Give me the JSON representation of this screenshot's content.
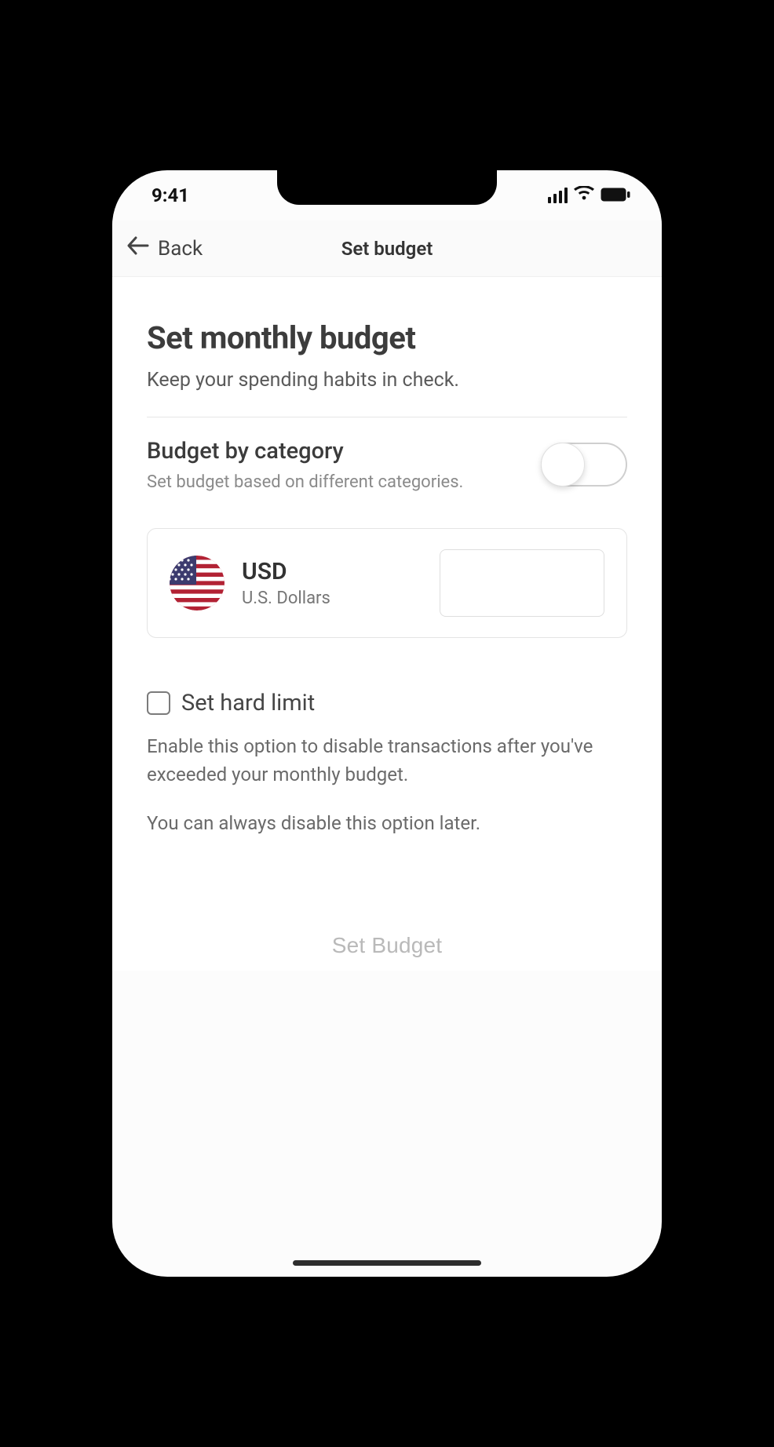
{
  "status": {
    "time": "9:41"
  },
  "nav": {
    "back_label": "Back",
    "title": "Set budget"
  },
  "header": {
    "title": "Set monthly budget",
    "subtitle": "Keep your spending habits in check."
  },
  "category_toggle": {
    "title": "Budget by category",
    "description": "Set budget based on different categories.",
    "on": false
  },
  "currency": {
    "code": "USD",
    "name": "U.S. Dollars",
    "flag": "us",
    "amount_value": ""
  },
  "hard_limit": {
    "checked": false,
    "label": "Set hard limit",
    "description": "Enable this option to disable transactions after you've exceeded your monthly budget.",
    "note": "You can always disable this option later."
  },
  "cta": {
    "label": "Set Budget"
  }
}
